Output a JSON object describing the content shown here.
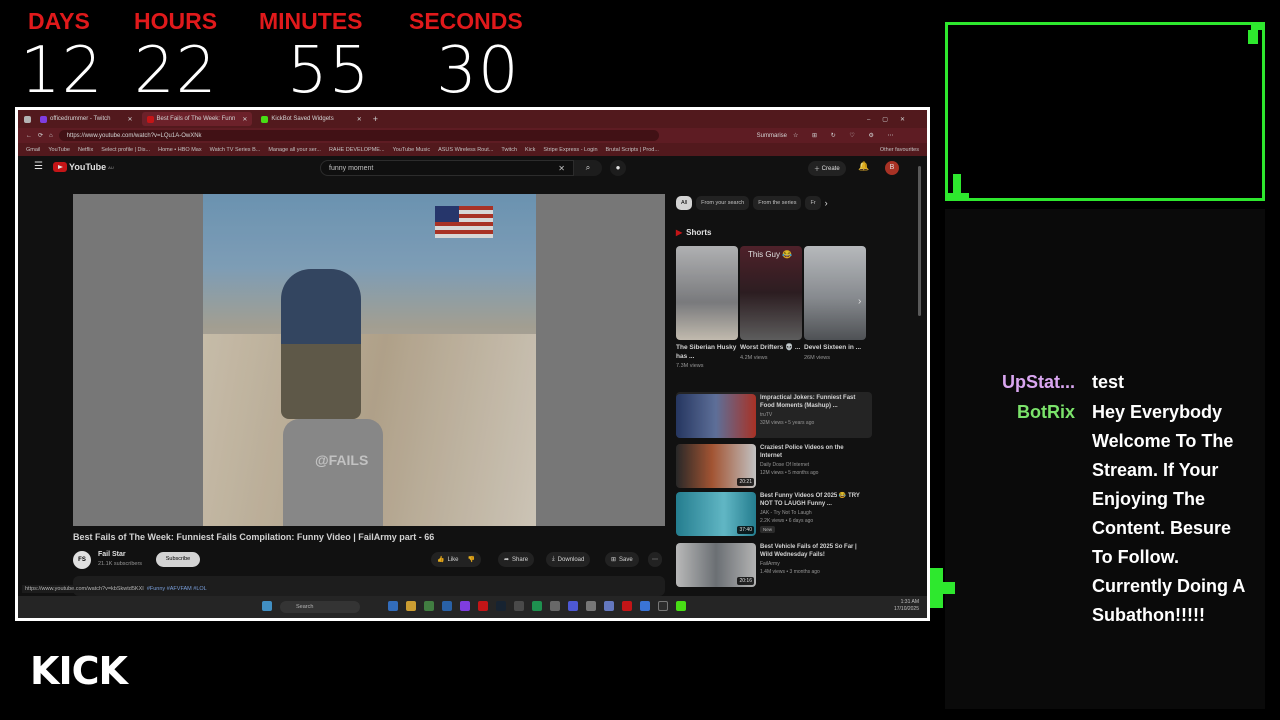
{
  "countdown": {
    "days_label": "DAYS",
    "days": "12",
    "hours_label": "HOURS",
    "hours": "22",
    "minutes_label": "MINUTES",
    "minutes": "55",
    "seconds_label": "SECONDS",
    "seconds": "30"
  },
  "browser": {
    "tabs": [
      "officedrummer - Twitch",
      "Best Fails of The Week: Funn",
      "KickBot Saved Widgets"
    ],
    "new_tab": "+",
    "url": "https://www.youtube.com/watch?v=LQu1A-OwXNk",
    "summarise": "Summarise",
    "bookmarks": [
      "Gmail",
      "YouTube",
      "Netflix",
      "Select profile | Dis...",
      "Home • HBO Max",
      "Watch TV Series B...",
      "Manage all your ser...",
      "RAHE DEVELOPME...",
      "YouTube Music",
      "ASUS Wireless Rout...",
      "Twitch",
      "Kick",
      "Stripe Express - Login",
      "Brutal Scripts | Prod..."
    ],
    "other_favourites": "Other favourites"
  },
  "youtube": {
    "logo": "YouTube",
    "logo_sup": "AU",
    "search_value": "funny moment",
    "create": "Create",
    "avatar": "B",
    "video_watermark": "@FAILS",
    "video_title": "Best Fails of The Week: Funniest Fails Compilation: Funny Video | FailArmy part - 66",
    "channel_avatar": "FS",
    "channel_name": "Fail Star",
    "channel_subs": "21.1K subscribers",
    "subscribe": "Subscribe",
    "like": "Like",
    "share": "Share",
    "download": "Download",
    "save": "Save",
    "chips": [
      "All",
      "From your search",
      "From the series",
      "Fr"
    ],
    "shorts_header": "Shorts",
    "shorts": [
      {
        "title": "The Siberian Husky has ...",
        "views": "7.3M views",
        "overlay": "",
        "color": "#a7a9ab"
      },
      {
        "title": "Worst Drifters 💀 ...",
        "views": "4.2M views",
        "overlay": "This Guy 😂",
        "color": "#5a3a40"
      },
      {
        "title": "Devel Sixteen in ...",
        "views": "26M views",
        "overlay": "",
        "color": "#9a9ea3"
      }
    ],
    "recommended": [
      {
        "title": "Impractical Jokers: Funniest Fast Food Moments (Mashup) ...",
        "channel": "truTV",
        "meta": "32M views • 5 years ago",
        "duration": "",
        "badge": "",
        "color": "#3a4f80"
      },
      {
        "title": "Craziest Police Videos on the Internet",
        "channel": "Daily Dose Of Internet",
        "meta": "12M views • 5 months ago",
        "duration": "20:21",
        "badge": "",
        "color": "#b9603a"
      },
      {
        "title": "Best Funny Videos Of 2025 😂 TRY NOT TO LAUGH Funny ...",
        "channel": "JAK - Try Not To Laugh",
        "meta": "2.2K views • 6 days ago",
        "duration": "37:40",
        "badge": "New",
        "color": "#3fb3c8"
      },
      {
        "title": "Best Vehicle Fails of 2025 So Far | Wild Wednesday Fails!",
        "channel": "FailArmy",
        "meta": "1.4M views • 3 months ago",
        "duration": "20:16",
        "badge": "",
        "color": "#7a7f84"
      }
    ],
    "status_url": "https://www.youtube.com/watch?v=kbSkwtd5KXI",
    "hashtags": "#Funny #AFVFAM #LOL"
  },
  "taskbar": {
    "search": "Search",
    "lang": "ENG\nUS",
    "time": "1:31 AM",
    "date": "17/10/2025"
  },
  "chat": {
    "messages": [
      {
        "user": "UpStat...",
        "user_color": "#d9a6f0",
        "text": "test"
      },
      {
        "user": "BotRix",
        "user_color": "#7be36b",
        "text": "Hey Everybody Welcome To The Stream. If Your Enjoying The Content. Besure To Follow. Currently Doing A Subathon!!!!!"
      }
    ]
  },
  "branding": {
    "logo": "KICK"
  },
  "colors": {
    "accent_red": "#e0191b",
    "frame_green": "#2ee82e"
  }
}
